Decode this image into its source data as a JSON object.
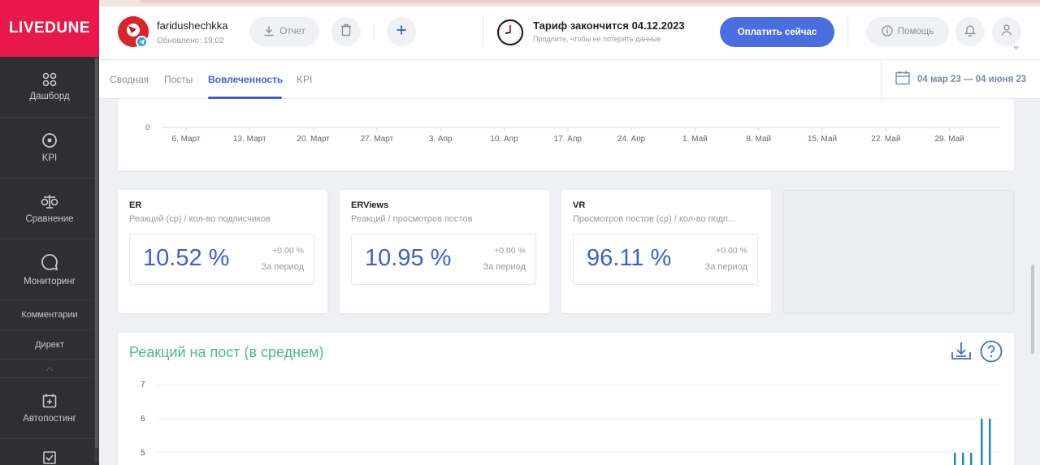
{
  "app": {
    "brand": "LIVEDUNE"
  },
  "sidebar": {
    "items": [
      {
        "label": "Дашборд",
        "icon": "dashboard-icon"
      },
      {
        "label": "KPI",
        "icon": "target-icon"
      },
      {
        "label": "Сравнение",
        "icon": "scales-icon"
      },
      {
        "label": "Мониторинг",
        "icon": "chat-bubble-icon"
      },
      {
        "label": "Комментарии"
      },
      {
        "label": "Директ"
      },
      {
        "label": "Автопостинг",
        "icon": "calendar-plus-icon"
      }
    ]
  },
  "header": {
    "account_name": "faridushechkka",
    "updated": "Обновлено: 19:02",
    "report_label": "Отчет",
    "tariff_title": "Тариф закончится 04.12.2023",
    "tariff_sub": "Продлите, чтобы не потерять данные",
    "pay_label": "Оплатить сейчас",
    "help_label": "Помощь"
  },
  "tabs": {
    "items": [
      "Сводная",
      "Посты",
      "Вовлеченность",
      "KPI"
    ],
    "active": "Вовлеченность",
    "date_range": "04 мар 23 — 04 июня 23"
  },
  "top_axis": {
    "zero_label": "0",
    "ticks": [
      "6. Март",
      "13. Март",
      "20. Март",
      "27. Март",
      "3. Апр",
      "10. Апр",
      "17. Апр",
      "24. Апр",
      "1. Май",
      "8. Май",
      "15. Май",
      "22. Май",
      "29. Май"
    ]
  },
  "metrics": [
    {
      "title": "ER",
      "subtitle": "Реакций (ср) / кол-во подписчиков",
      "value": "10.52 %",
      "delta": "+0.00 %",
      "period": "За период"
    },
    {
      "title": "ERViews",
      "subtitle": "Реакций / просмотров постов",
      "value": "10.95 %",
      "delta": "+0.00 %",
      "period": "За период"
    },
    {
      "title": "VR",
      "subtitle": "Просмотров постов (ср) / кол-во подп...",
      "value": "96.11 %",
      "delta": "+0.00 %",
      "period": "За период"
    }
  ],
  "reactions_chart": {
    "title": "Реакций на пост (в среднем)",
    "y_ticks": [
      "7",
      "6",
      "5"
    ]
  },
  "colors": {
    "brand": "#e8184b",
    "accent": "#3d5fd1",
    "chart_title": "#4fb49a",
    "bars": "#1e88c4"
  }
}
